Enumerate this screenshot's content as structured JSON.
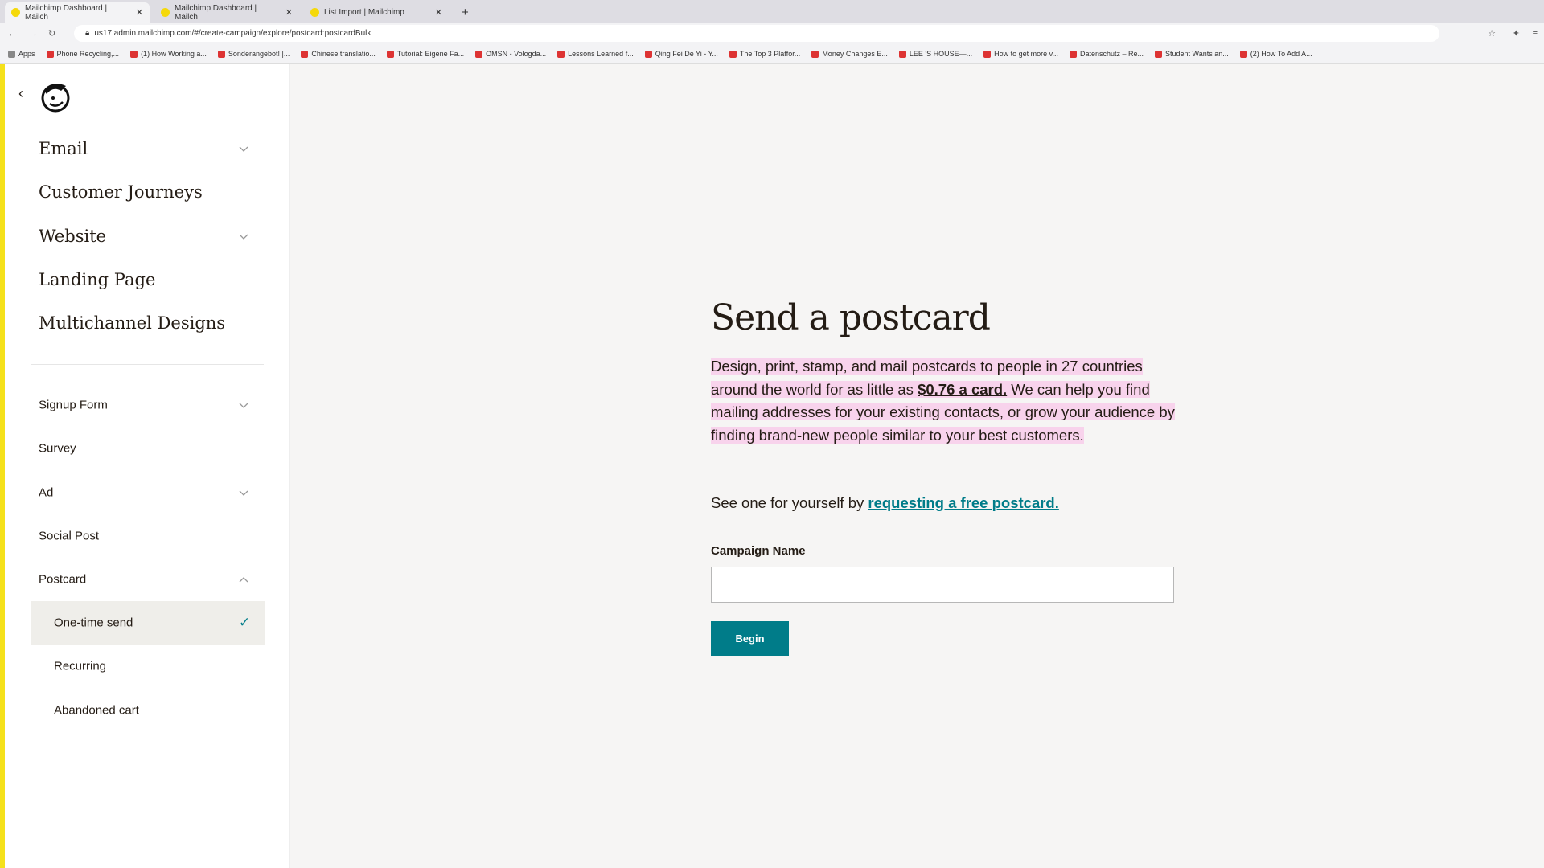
{
  "browser": {
    "tabs": [
      {
        "title": "Mailchimp Dashboard | Mailch"
      },
      {
        "title": "Mailchimp Dashboard | Mailch"
      },
      {
        "title": "List Import | Mailchimp"
      }
    ],
    "url": "us17.admin.mailchimp.com/#/create-campaign/explore/postcard:postcardBulk",
    "bookmarks": [
      "Apps",
      "Phone Recycling,...",
      "(1) How Working a...",
      "Sonderangebot! |...",
      "Chinese translatio...",
      "Tutorial: Eigene Fa...",
      "OMSN - Vologda...",
      "Lessons Learned f...",
      "Qing Fei De Yi - Y...",
      "The Top 3 Platfor...",
      "Money Changes E...",
      "LEE 'S HOUSE—...",
      "How to get more v...",
      "Datenschutz – Re...",
      "Student Wants an...",
      "(2) How To Add A..."
    ]
  },
  "sidebar": {
    "primary": [
      {
        "label": "Email",
        "chevron": "down"
      },
      {
        "label": "Customer Journeys"
      },
      {
        "label": "Website",
        "chevron": "down"
      },
      {
        "label": "Landing Page"
      },
      {
        "label": "Multichannel Designs"
      }
    ],
    "secondary": [
      {
        "label": "Signup Form",
        "chevron": "down"
      },
      {
        "label": "Survey"
      },
      {
        "label": "Ad",
        "chevron": "down"
      },
      {
        "label": "Social Post"
      },
      {
        "label": "Postcard",
        "chevron": "up"
      }
    ],
    "postcard_items": [
      {
        "label": "One-time send",
        "selected": true
      },
      {
        "label": "Recurring"
      },
      {
        "label": "Abandoned cart"
      }
    ]
  },
  "main": {
    "title": "Send a postcard",
    "para_1": "Design, print, stamp, and mail postcards to people in 27 countries around the world for as little as ",
    "price_link": "$0.76 a card.",
    "para_2": " We can help you find mailing addresses for your existing contacts, or grow your audience by finding brand-new people similar to your best customers.",
    "see_text": "See one for yourself by ",
    "see_link": "requesting a free postcard.",
    "campaign_label": "Campaign Name",
    "campaign_value": "",
    "begin_label": "Begin"
  },
  "colors": {
    "accent": "#007c89",
    "highlight": "#f8d3ec",
    "brand_yellow": "#f5e11b"
  }
}
